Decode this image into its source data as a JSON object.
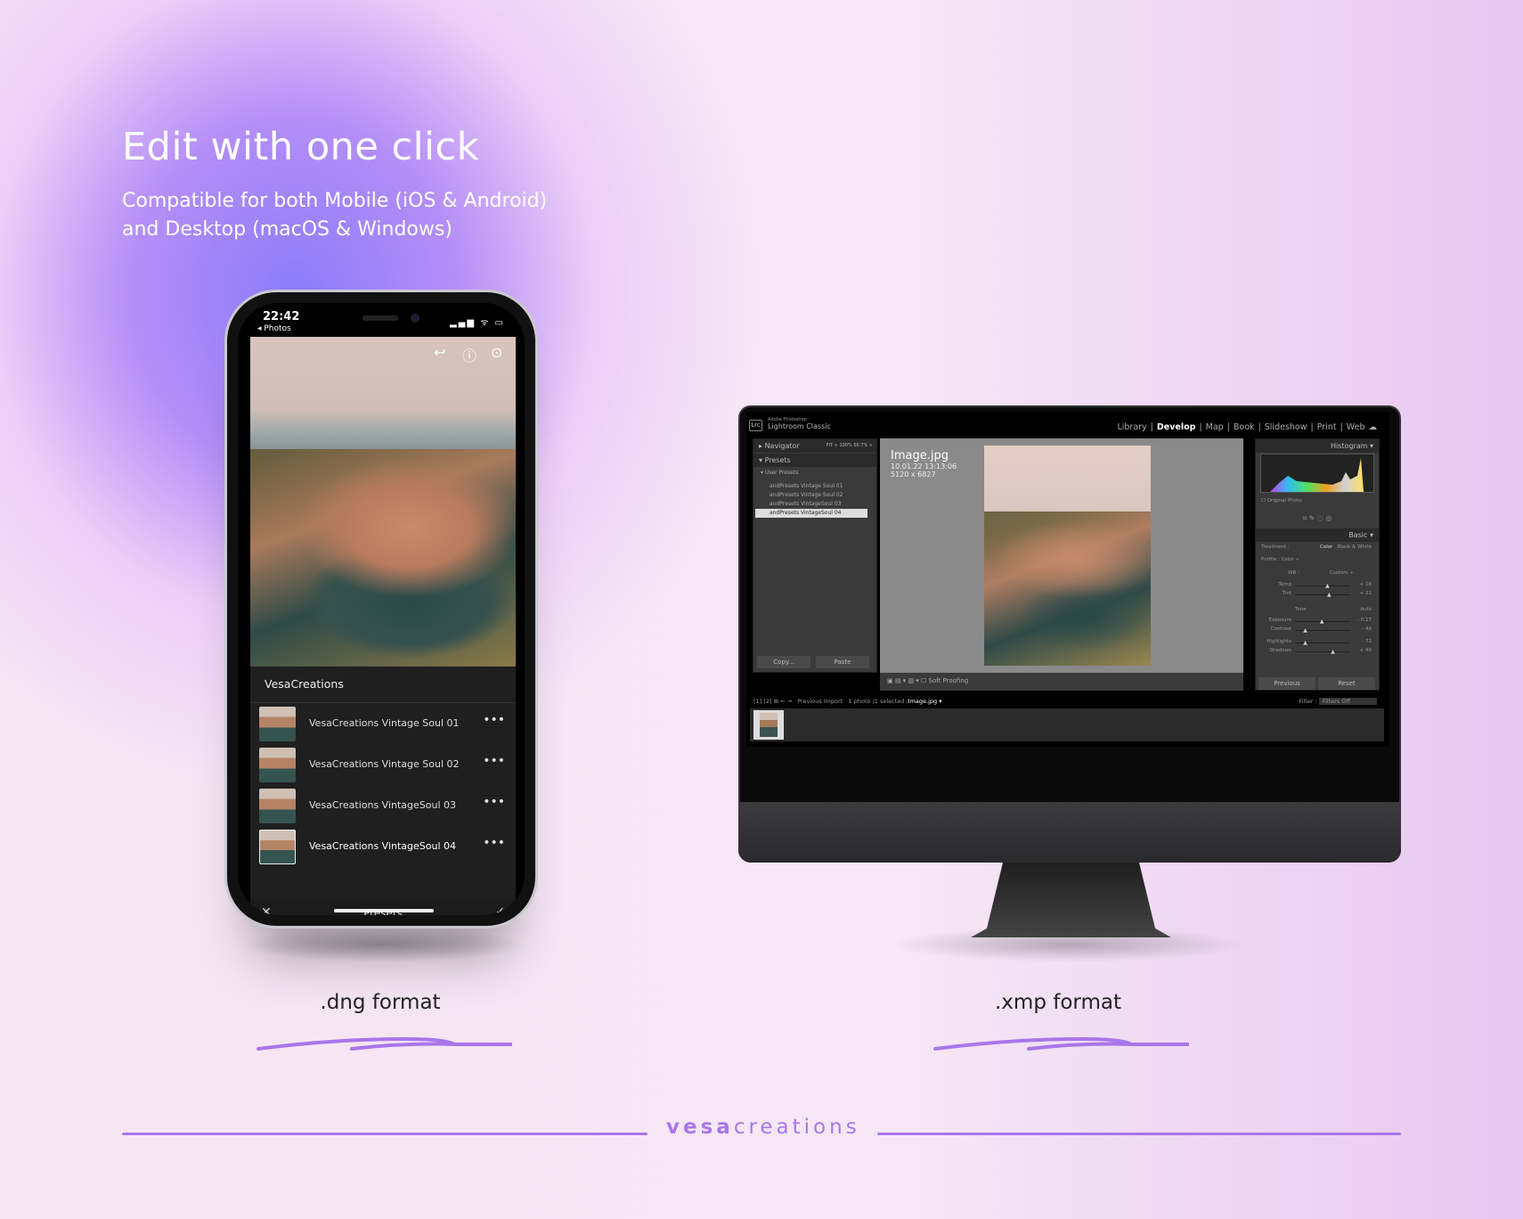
{
  "headline": {
    "title": "Edit with one click",
    "subtitle_line1": "Compatible for both Mobile (iOS & Android)",
    "subtitle_line2": "and Desktop (macOS & Windows)"
  },
  "phone": {
    "status": {
      "time": "22:42",
      "back": "◂ Photos",
      "icons": "▂▄▆ ᯤ ▭"
    },
    "toolbar_icons": [
      "undo-icon",
      "help-icon",
      "more-icon"
    ],
    "sheet_title": "VesaCreations",
    "presets": [
      {
        "label": "VesaCreations Vintage Soul 01"
      },
      {
        "label": "VesaCreations Vintage Soul 02"
      },
      {
        "label": "VesaCreations VintageSoul 03"
      },
      {
        "label": "VesaCreations VintageSoul 04",
        "selected": true
      }
    ],
    "bottom_title": "Presets",
    "more": "•••",
    "close": "✕",
    "confirm": "✓"
  },
  "lightroom": {
    "logo": "Lrc",
    "brand_small": "Adobe Photoshop",
    "brand": "Lightroom Classic",
    "modules": [
      "Library",
      "Develop",
      "Map",
      "Book",
      "Slideshow",
      "Print",
      "Web"
    ],
    "active_module": "Develop",
    "navigator": "Navigator",
    "navigator_zoom": "FIT ÷  100%  56.7% ÷",
    "presets": "Presets",
    "user_presets": "User Presets",
    "preset_items": [
      "andPresets Vintage Soul 01",
      "andPresets Vintage Soul 02",
      "andPresets VintageSoul 03",
      "andPresets VintageSoul 04"
    ],
    "copy": "Copy...",
    "paste": "Paste",
    "image": {
      "name": "Image.jpg",
      "date": "10.01.22 13:13:06",
      "size": "5120 x 6827"
    },
    "soft_proofing": "Soft Proofing",
    "histogram": "Histogram",
    "original_photo": "Original Photo",
    "basic": "Basic",
    "treatment": "Treatment :",
    "color": "Color",
    "bw": "Black & White",
    "profile": "Profile :",
    "profile_value": "Color ÷",
    "wb": "WB :",
    "wb_value": "Custom ÷",
    "tone": "Tone",
    "auto": "Auto",
    "sliders": [
      {
        "label": "Temp",
        "value": "+ 16"
      },
      {
        "label": "Tint",
        "value": "+ 21"
      },
      {
        "label": "Exposure",
        "value": "- 0.17"
      },
      {
        "label": "Contrast",
        "value": "- 49"
      },
      {
        "label": "Highlights",
        "value": "- 71"
      },
      {
        "label": "Shadows",
        "value": "+ 40"
      }
    ],
    "slider_levels": [
      0.55,
      0.58,
      0.45,
      0.15,
      0.15,
      0.65
    ],
    "previous": "Previous",
    "reset": "Reset",
    "filmstrip": {
      "source": "Previous Import",
      "info": "1 photo /1 selected /",
      "file": "Image.jpg ▾",
      "filter_label": "Filter :",
      "filter_value": "Filters Off"
    }
  },
  "labels": {
    "mobile": ".dng format",
    "desktop": ".xmp format"
  },
  "footer": {
    "brand_bold": "vesa",
    "brand_light": "creations"
  },
  "colors": {
    "accent": "#a876ea",
    "lr_bg": "#3a3a3a"
  }
}
